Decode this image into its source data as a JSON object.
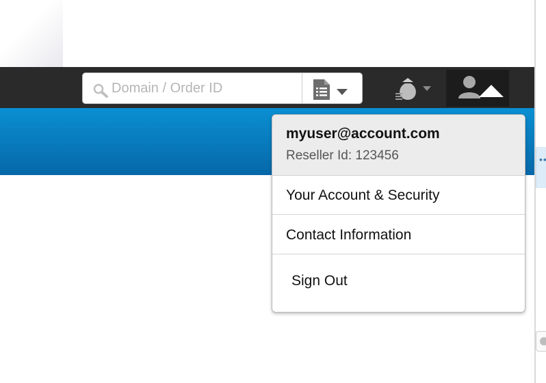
{
  "search": {
    "placeholder": "Domain / Order ID"
  },
  "header": {
    "search_icon": "search-icon",
    "filter_icon": "document-list-icon",
    "money_icon": "money-bag-icon",
    "user_icon": "user-icon"
  },
  "account_menu": {
    "email": "myuser@account.com",
    "reseller_id": "Reseller Id: 123456",
    "items": [
      {
        "label": "Your Account & Security"
      },
      {
        "label": "Contact Information"
      },
      {
        "label": "Sign Out"
      }
    ]
  },
  "colors": {
    "topbar": "#2a2a2a",
    "brand_blue": "#0a8fd2"
  }
}
